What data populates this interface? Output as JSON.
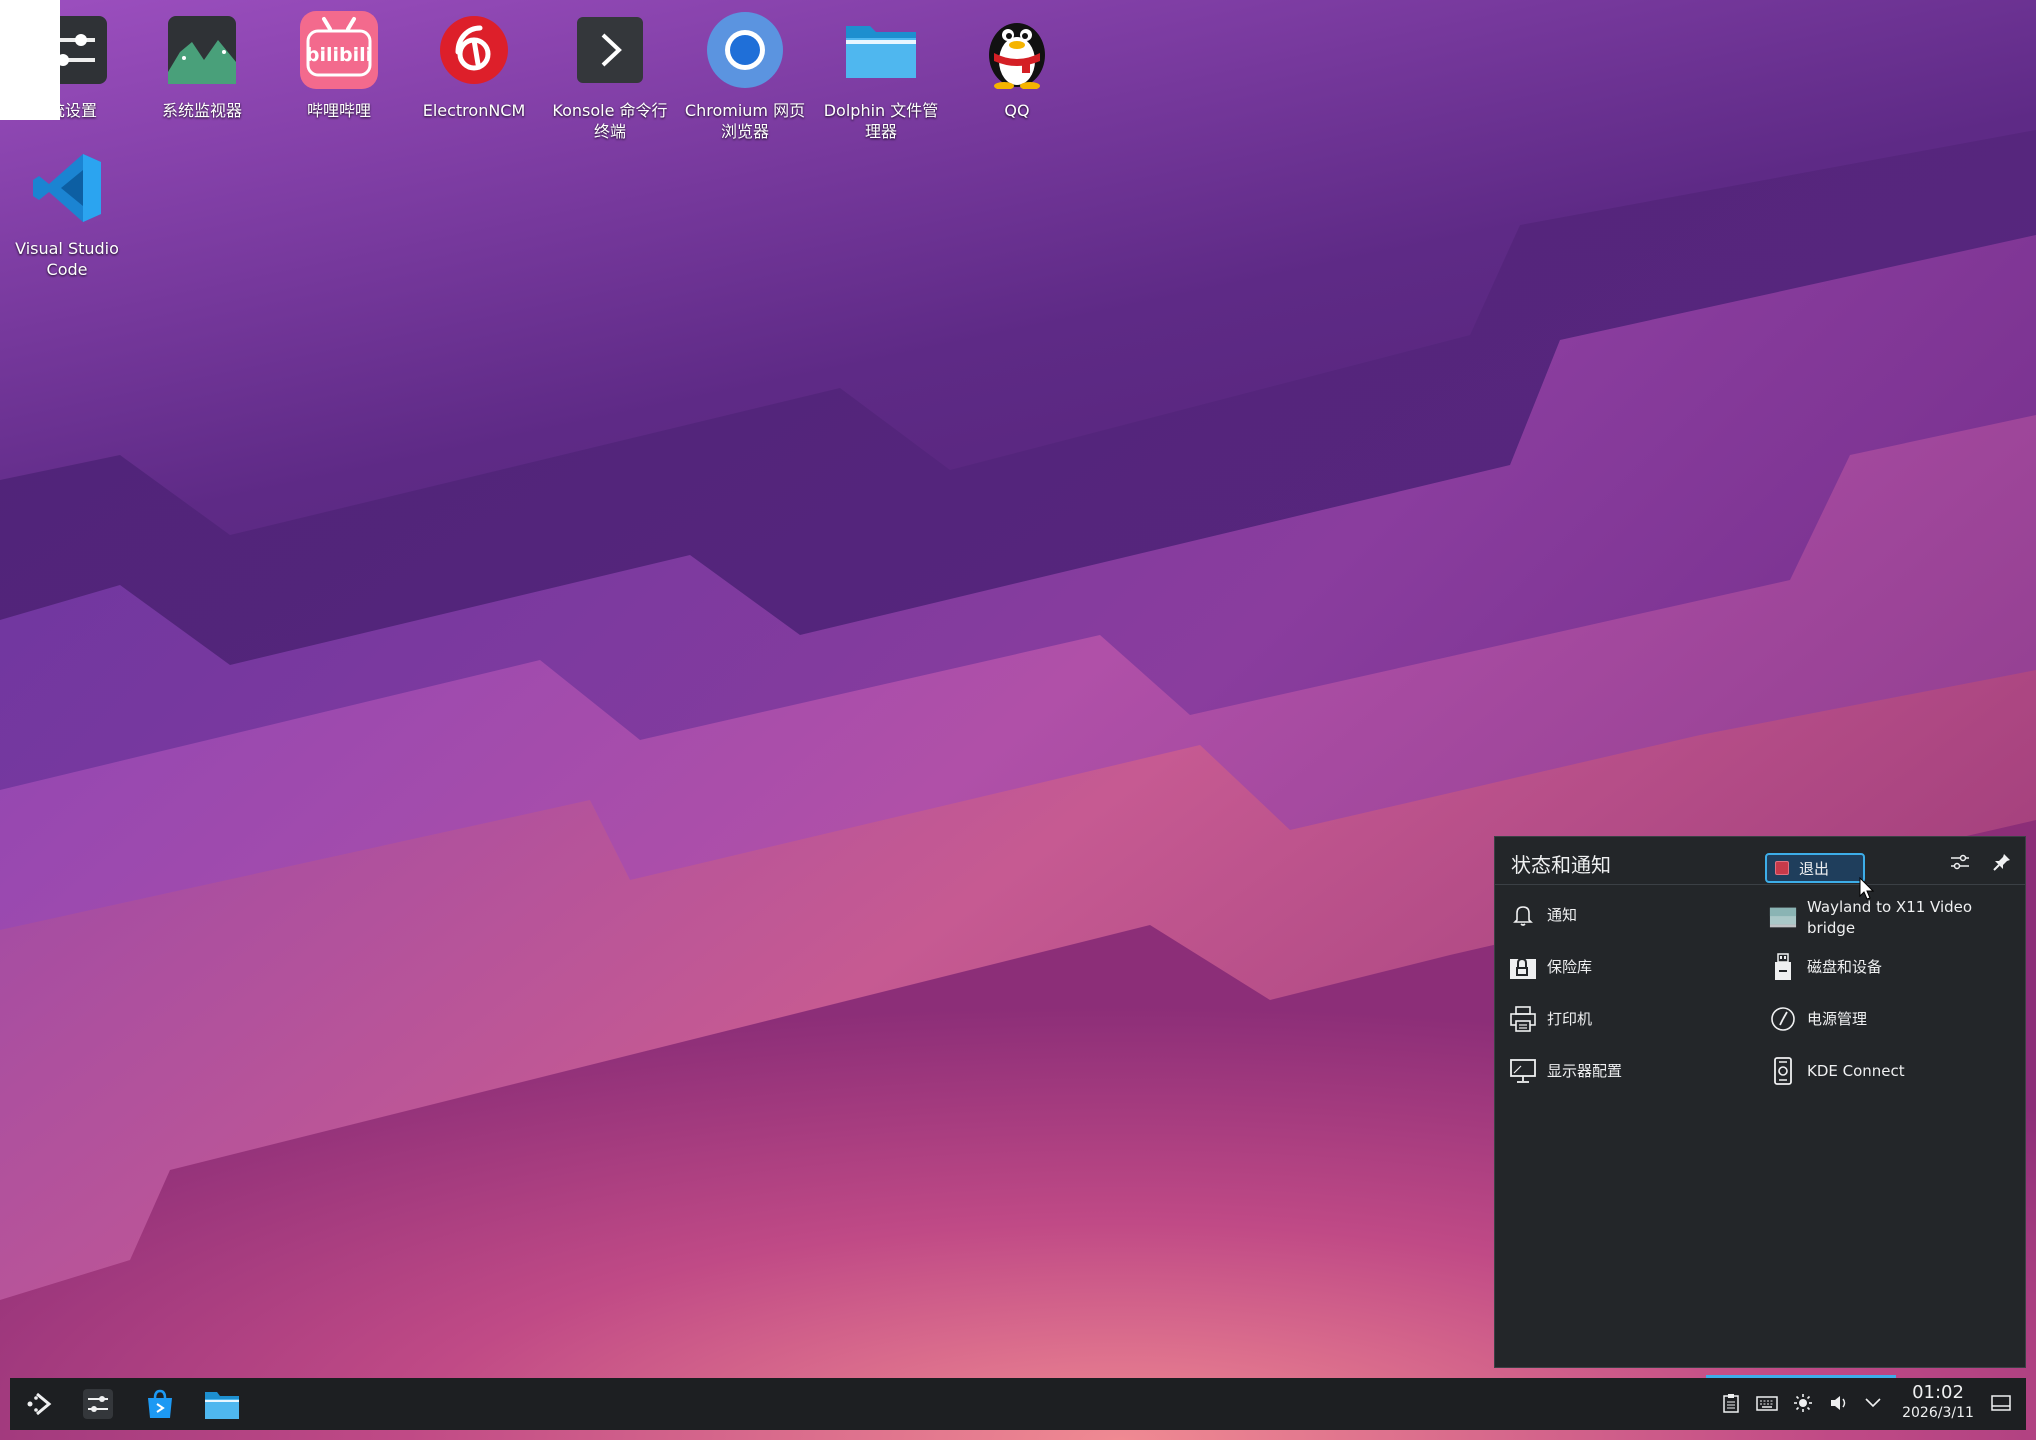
{
  "desktop": {
    "icons": [
      {
        "label": "统设置",
        "icon": "system-settings-icon"
      },
      {
        "label": "系统监视器",
        "icon": "system-monitor-icon"
      },
      {
        "label": "哔哩哔哩",
        "icon": "bilibili-icon"
      },
      {
        "label": "ElectronNCM",
        "icon": "netease-music-icon"
      },
      {
        "label": "Konsole 命令行终端",
        "icon": "terminal-icon"
      },
      {
        "label": "Chromium 网页浏览器",
        "icon": "chromium-icon"
      },
      {
        "label": "Dolphin 文件管理器",
        "icon": "folder-icon"
      },
      {
        "label": "QQ",
        "icon": "qq-penguin-icon"
      },
      {
        "label": "Visual Studio Code",
        "icon": "vscode-icon"
      }
    ],
    "bilibili_text": "bilibili"
  },
  "tray_popup": {
    "title": "状态和通知",
    "tooltip": "退出",
    "items": [
      {
        "label": "通知",
        "icon": "bell-icon"
      },
      {
        "label": "Wayland to X11 Video bridge",
        "icon": "video-bridge-icon"
      },
      {
        "label": "保险库",
        "icon": "vault-lock-icon"
      },
      {
        "label": "磁盘和设备",
        "icon": "usb-drive-icon"
      },
      {
        "label": "打印机",
        "icon": "printer-icon"
      },
      {
        "label": "电源管理",
        "icon": "power-gauge-icon"
      },
      {
        "label": "显示器配置",
        "icon": "monitor-icon"
      },
      {
        "label": "KDE Connect",
        "icon": "kde-connect-icon"
      }
    ]
  },
  "taskbar": {
    "launchers": [
      "app-launcher-icon",
      "system-settings-icon",
      "discover-store-icon",
      "dolphin-icon"
    ],
    "tray_icons": [
      "clipboard-icon",
      "keyboard-icon",
      "brightness-icon",
      "volume-icon",
      "expand-tray-icon"
    ],
    "clock": {
      "time": "01:02",
      "date": "2026/3/11"
    },
    "show_desktop": "show-desktop-icon"
  },
  "colors": {
    "panel_bg": "#232629",
    "accent": "#3daee9",
    "taskbar_bg": "#1d1f22"
  }
}
